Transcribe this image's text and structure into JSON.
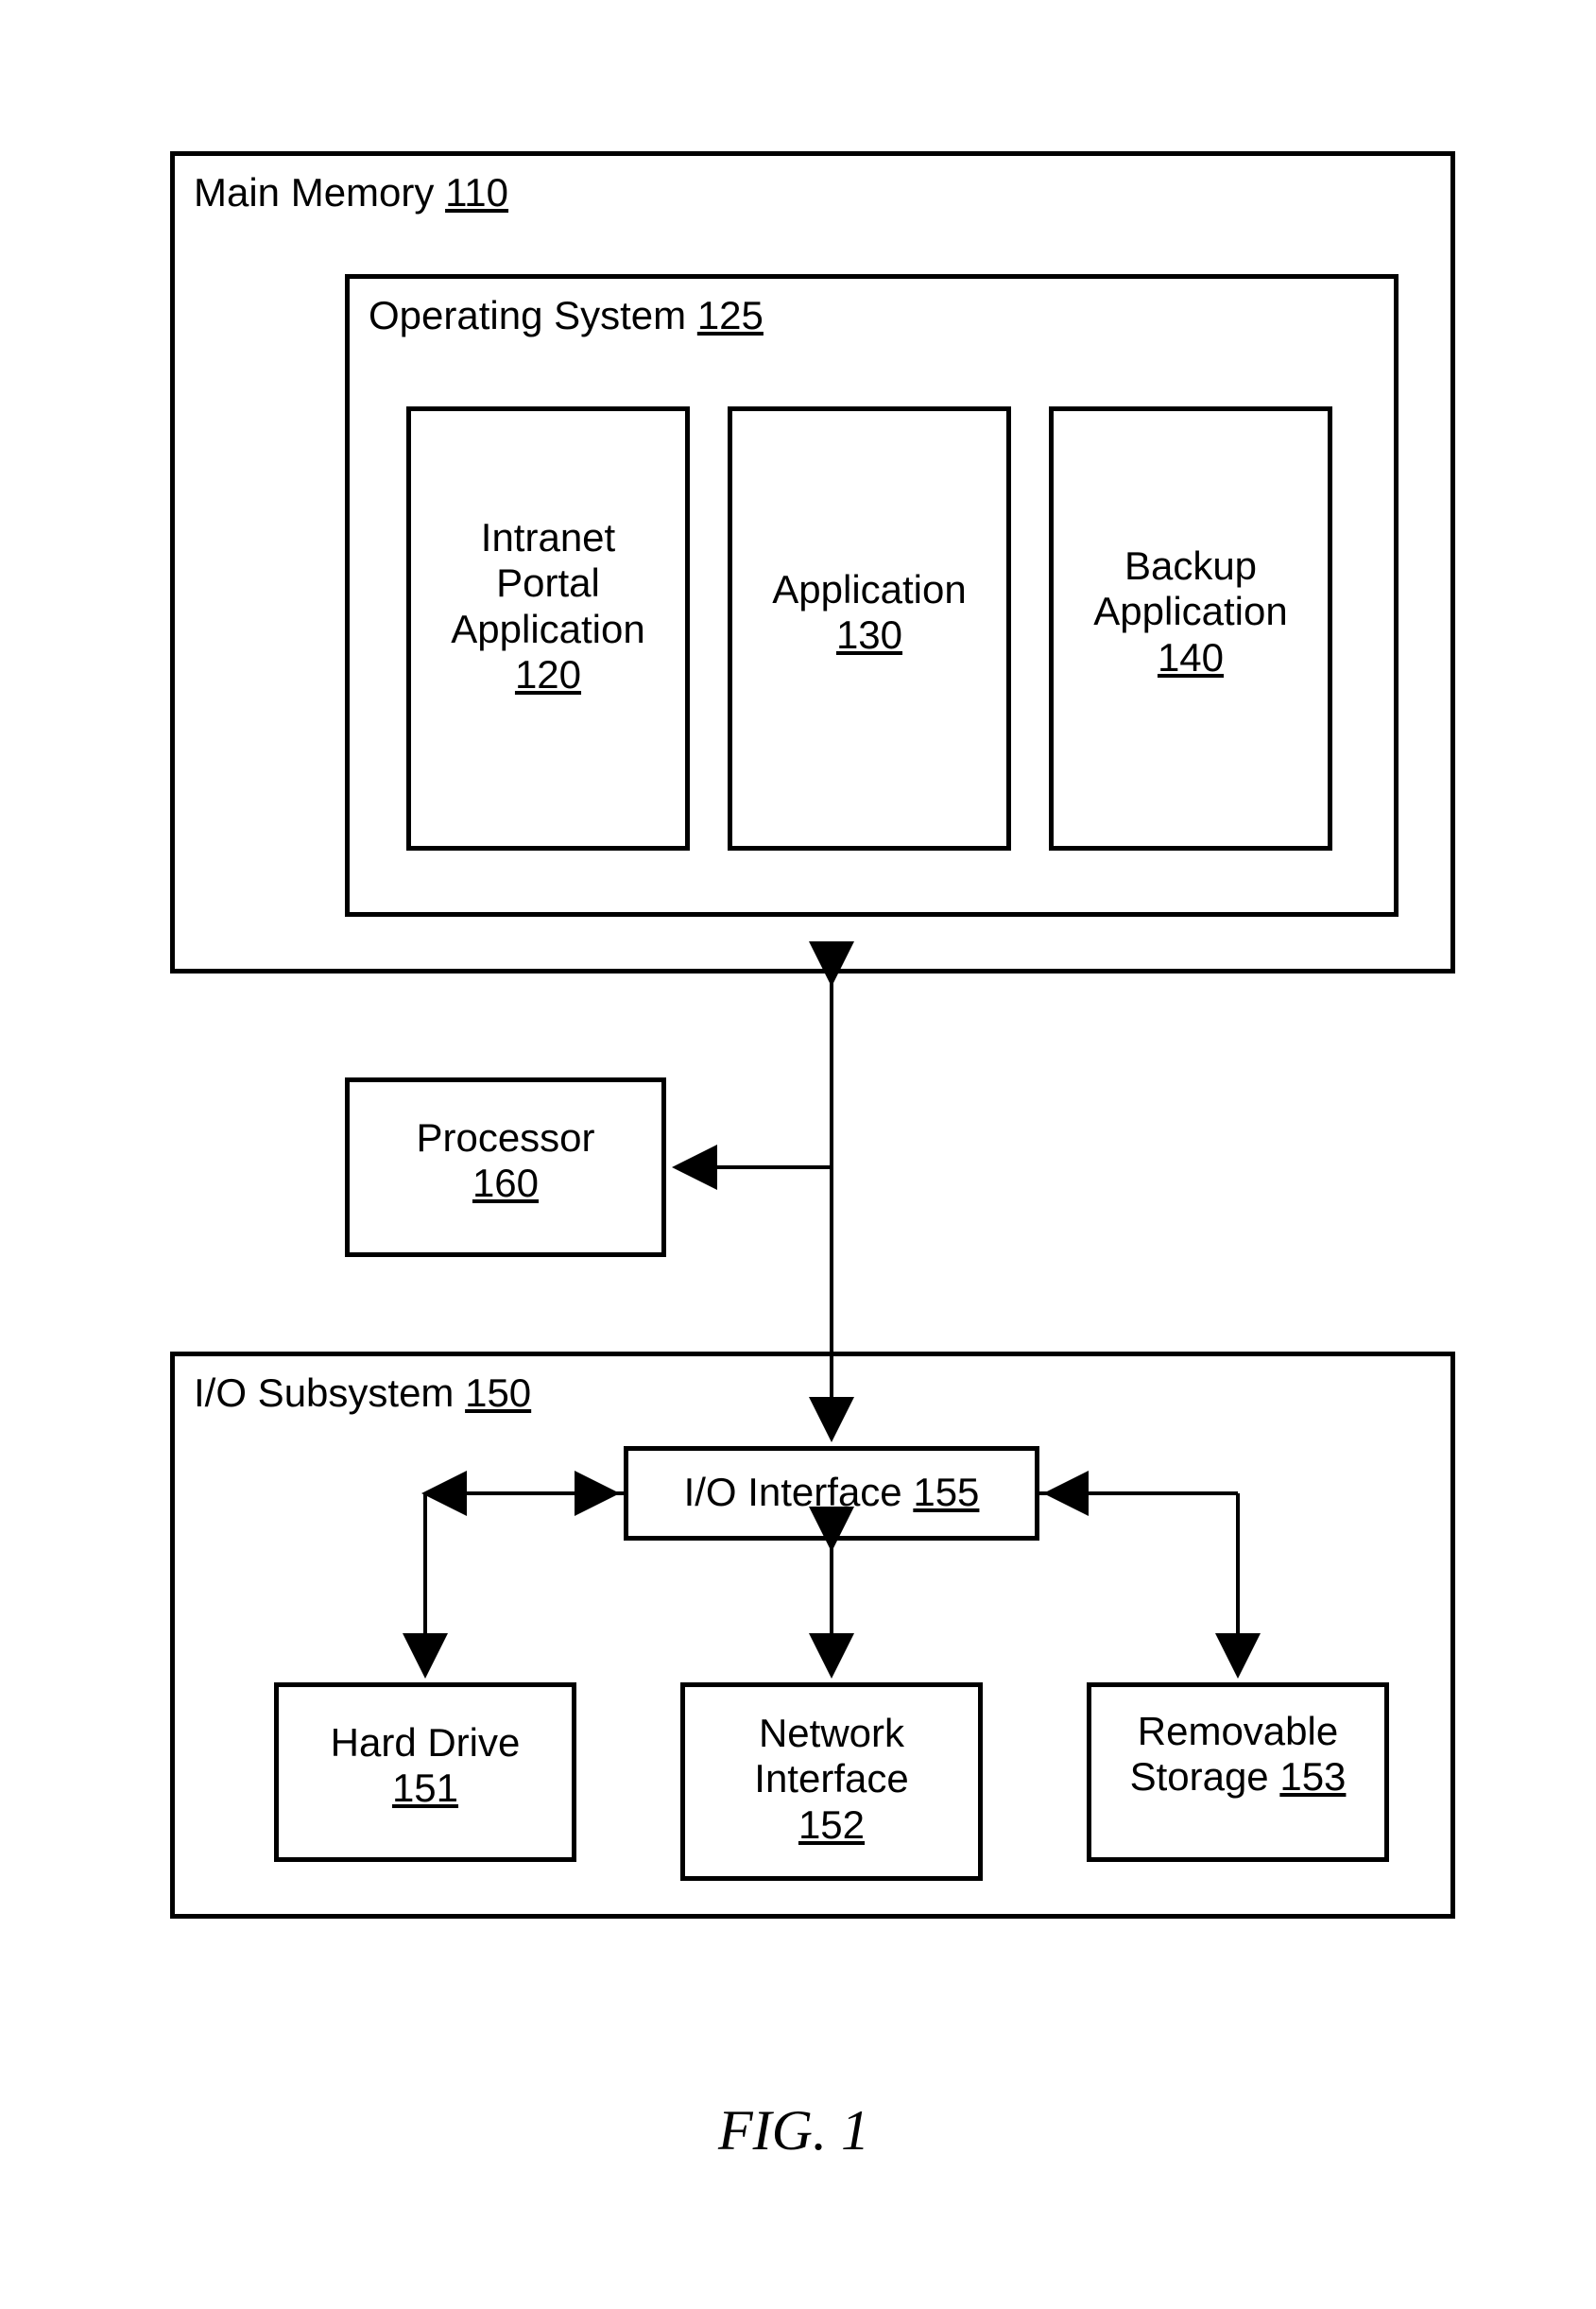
{
  "figure_label": "FIG. 1",
  "main_memory": {
    "name": "Main Memory",
    "ref": "110"
  },
  "operating_system": {
    "name": "Operating System",
    "ref": "125"
  },
  "apps": {
    "intranet": {
      "l1": "Intranet",
      "l2": "Portal",
      "l3": "Application",
      "ref": "120"
    },
    "application": {
      "l1": "Application",
      "ref": "130"
    },
    "backup": {
      "l1": "Backup",
      "l2": "Application",
      "ref": "140"
    }
  },
  "processor": {
    "name": "Processor",
    "ref": "160"
  },
  "io_subsystem": {
    "name": "I/O Subsystem",
    "ref": "150"
  },
  "io_interface": {
    "name": "I/O Interface",
    "ref": "155"
  },
  "hard_drive": {
    "name": "Hard Drive",
    "ref": "151"
  },
  "network_interface": {
    "l1": "Network",
    "l2": "Interface",
    "ref": "152"
  },
  "removable_storage": {
    "l1": "Removable",
    "l2": "Storage",
    "ref": "153"
  }
}
